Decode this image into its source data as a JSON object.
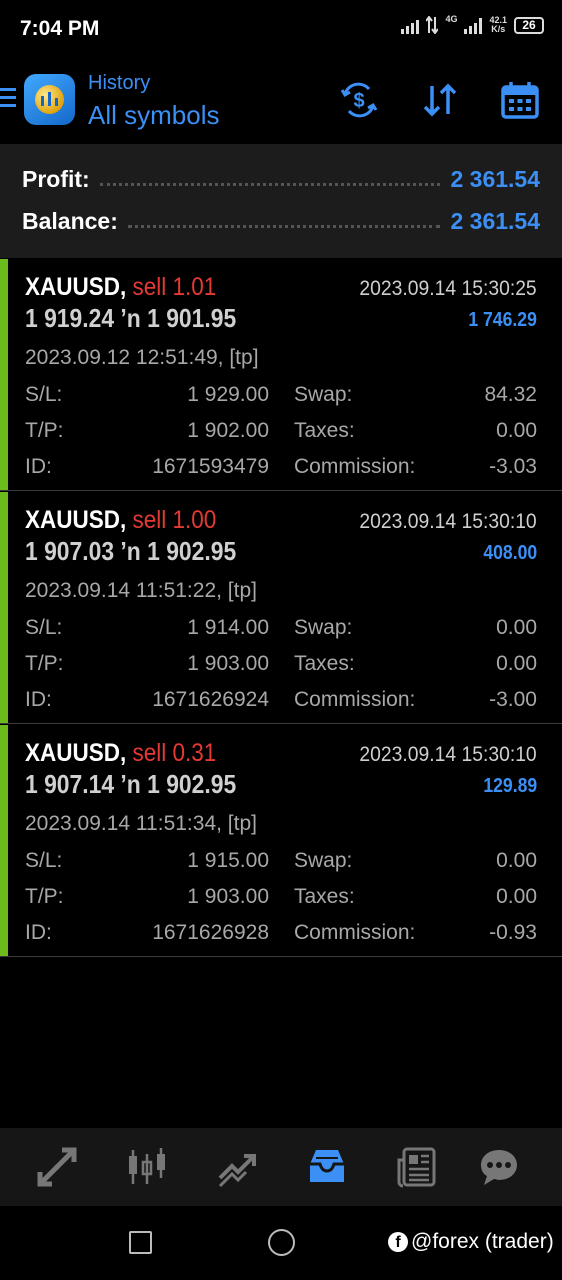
{
  "status_bar": {
    "time": "7:04 PM",
    "network_tag": "4G",
    "speed_value": "42.1",
    "speed_unit": "K/s",
    "battery": "26"
  },
  "header": {
    "subtitle": "History",
    "title": "All symbols",
    "icons": [
      "menu-icon",
      "app-logo",
      "currency-sort-icon",
      "sort-arrows-icon",
      "calendar-icon"
    ]
  },
  "summary": {
    "profit_label": "Profit:",
    "profit_value": "2 361.54",
    "balance_label": "Balance:",
    "balance_value": "2 361.54"
  },
  "labels": {
    "sl": "S/L:",
    "tp": "T/P:",
    "id": "ID:",
    "swap": "Swap:",
    "taxes": "Taxes:",
    "commission": "Commission:"
  },
  "deals": [
    {
      "symbol": "XAUUSD,",
      "type": "sell 1.01",
      "close_time": "2023.09.14 15:30:25",
      "prices": "1 919.24 ’n  1 901.95",
      "profit": "1 746.29",
      "open_time": "2023.09.12 12:51:49, [tp]",
      "sl": "1 929.00",
      "tp": "1 902.00",
      "id": "1671593479",
      "swap": "84.32",
      "taxes": "0.00",
      "commission": "-3.03"
    },
    {
      "symbol": "XAUUSD,",
      "type": "sell 1.00",
      "close_time": "2023.09.14 15:30:10",
      "prices": "1 907.03 ’n  1 902.95",
      "profit": "408.00",
      "open_time": "2023.09.14 11:51:22, [tp]",
      "sl": "1 914.00",
      "tp": "1 903.00",
      "id": "1671626924",
      "swap": "0.00",
      "taxes": "0.00",
      "commission": "-3.00"
    },
    {
      "symbol": "XAUUSD,",
      "type": "sell 0.31",
      "close_time": "2023.09.14 15:30:10",
      "prices": "1 907.14 ’n  1 902.95",
      "profit": "129.89",
      "open_time": "2023.09.14 11:51:34, [tp]",
      "sl": "1 915.00",
      "tp": "1 903.00",
      "id": "1671626928",
      "swap": "0.00",
      "taxes": "0.00",
      "commission": "-0.93"
    }
  ],
  "bottom_nav": {
    "items": [
      "quotes-icon",
      "chart-icon",
      "trade-icon",
      "history-icon",
      "news-icon",
      "messages-icon"
    ],
    "active": "history-icon"
  },
  "watermark": {
    "text": "@forex (trader)"
  },
  "colors": {
    "accent_blue": "#3b8ff5",
    "sell_red": "#e53935",
    "profit_bar_green": "#6cbb1c",
    "background": "#000000",
    "summary_bg": "#1c1c1c"
  }
}
